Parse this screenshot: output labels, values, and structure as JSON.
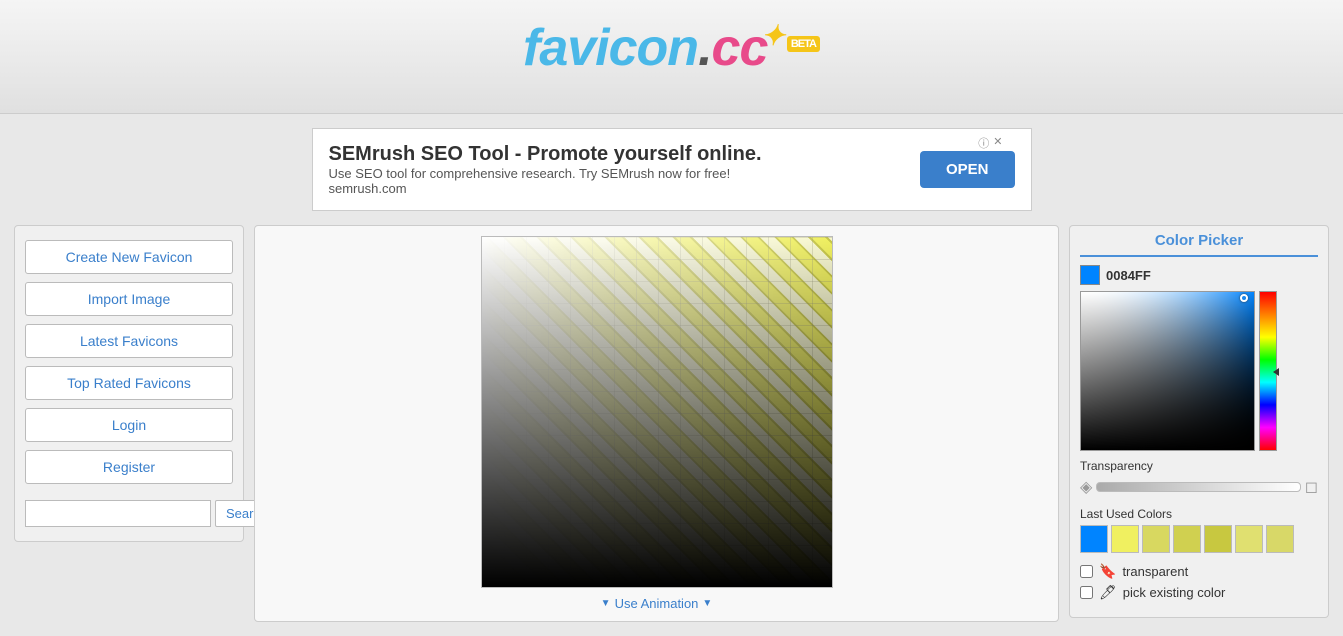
{
  "header": {
    "logo_favicon": "favicon",
    "logo_dot": ".",
    "logo_cc": "cc",
    "logo_beta": "BETA",
    "reflection_text": "favicon.cc"
  },
  "ad": {
    "title": "SEMrush SEO Tool - Promote yourself online.",
    "description": "Use SEO tool for comprehensive research. Try SEMrush now for free!",
    "domain": "semrush.com",
    "button_label": "OPEN",
    "info_icon": "ⓘ",
    "close_icon": "✕"
  },
  "sidebar": {
    "create_label": "Create New Favicon",
    "import_label": "Import Image",
    "latest_label": "Latest Favicons",
    "top_rated_label": "Top Rated Favicons",
    "login_label": "Login",
    "register_label": "Register",
    "search_placeholder": "",
    "search_button_label": "Search"
  },
  "canvas": {
    "animation_label": "Use Animation"
  },
  "color_picker": {
    "title": "Color Picker",
    "hex_value": "0084FF",
    "transparency_label": "Transparency",
    "last_used_label": "Last Used Colors",
    "colors": [
      "#0084ff",
      "#f0f060",
      "#d8d860",
      "#d0d050",
      "#c8c840",
      "#e0e070",
      "#d8d868"
    ],
    "transparent_label": "transparent",
    "pick_color_label": "pick existing color"
  }
}
